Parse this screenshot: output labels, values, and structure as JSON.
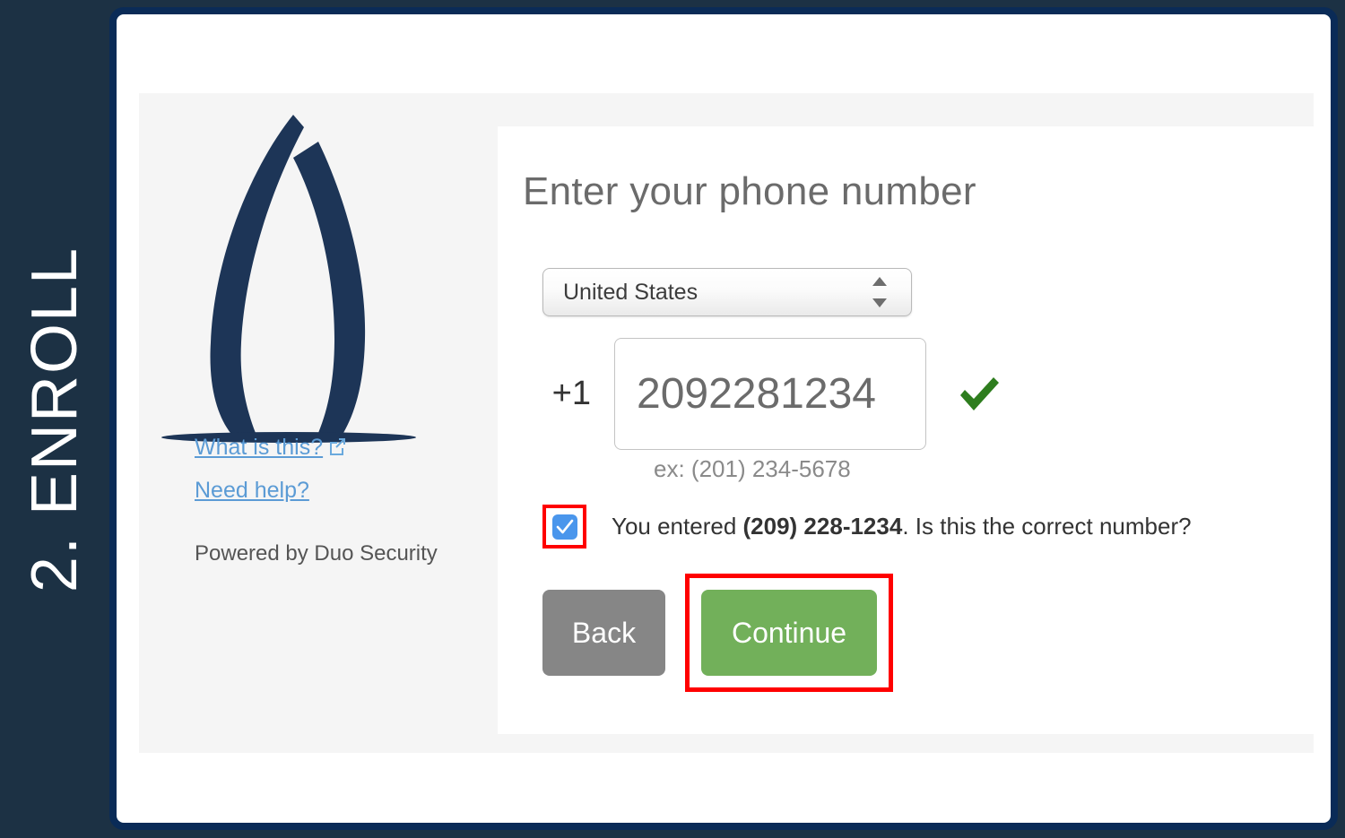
{
  "sidebar": {
    "step_label": "2. ENROLL",
    "background_color": "#1c3144"
  },
  "card": {
    "border_color": "#0a2b57",
    "panel_background": "#f5f5f5"
  },
  "brand": {
    "logo_name": "duo-security-logo",
    "logo_color": "#1d3557",
    "links": [
      {
        "label": "What is this?",
        "has_external_icon": true
      },
      {
        "label": "Need help?",
        "has_external_icon": false
      }
    ],
    "powered_by": "Powered by Duo Security",
    "link_color": "#5b9bd5"
  },
  "form": {
    "title": "Enter your phone number",
    "country": {
      "label": "country-select",
      "selected": "United States",
      "options": [
        "United States"
      ]
    },
    "phone": {
      "country_code": "+1",
      "value": "2092281234",
      "placeholder": "",
      "hint": "ex: (201) 234-5678",
      "valid": true,
      "valid_icon_color": "#2e7d1e"
    },
    "confirm": {
      "checked": true,
      "checkbox_color": "#4a96ec",
      "highlight_color": "#ff0000",
      "text_before": "You entered ",
      "text_number": "(209) 228-1234",
      "text_after": ". Is this the correct number?"
    },
    "buttons": {
      "back_label": "Back",
      "back_color": "#868686",
      "continue_label": "Continue",
      "continue_color": "#72b05a",
      "continue_highlight_color": "#ff0000"
    }
  }
}
